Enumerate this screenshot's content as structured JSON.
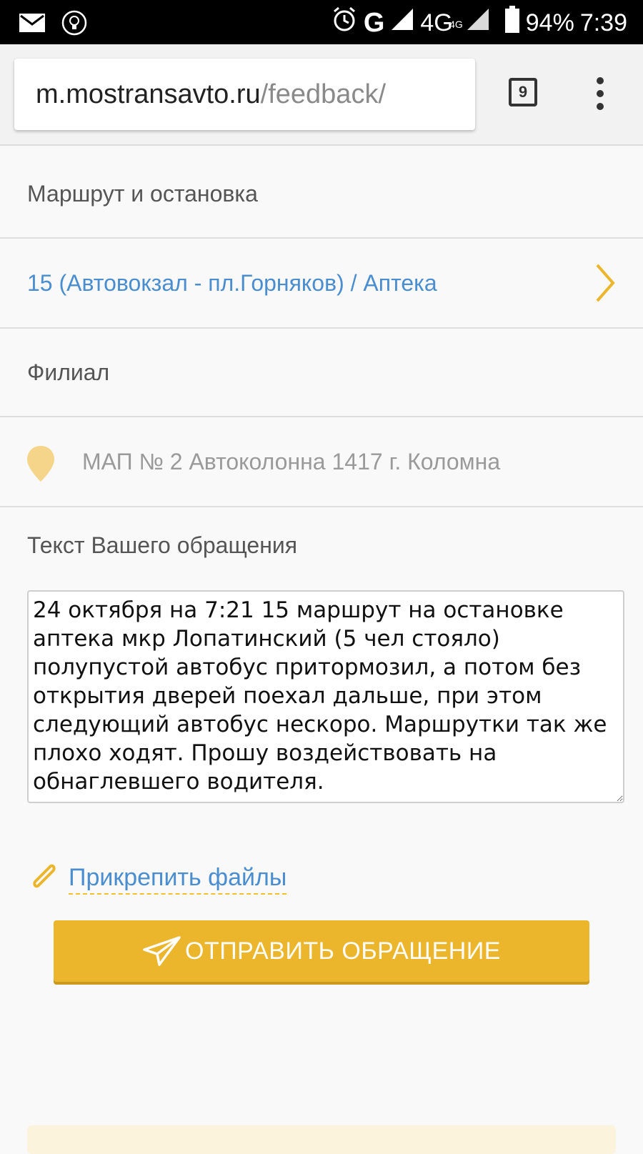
{
  "status_bar": {
    "network_g": "G",
    "network_4g": "4G",
    "network_4g_small": "4G",
    "battery": "94%",
    "time": "7:39"
  },
  "browser": {
    "url_host": "m.mostransavto.ru",
    "url_path": "/feedback/",
    "tab_count": "9"
  },
  "form": {
    "route_label": "Маршрут и остановка",
    "route_value": "15 (Автовокзал - пл.Горняков) / Аптека",
    "branch_label": "Филиал",
    "branch_value": "МАП № 2 Автоколонна 1417 г. Коломна",
    "text_label": "Текст Вашего обращения",
    "text_value": "24 октября на 7:21 15 маршрут на остановке аптека мкр Лопатинский (5 чел стояло) полупустой автобус притормозил, а потом без открытия дверей поехал дальше, при этом следующий автобус нескоро. Маршрутки так же плохо ходят. Прошу воздействовать на обнаглевшего водителя.",
    "attach_label": "Прикрепить файлы",
    "submit_label": "ОТПРАВИТЬ ОБРАЩЕНИЕ"
  },
  "colors": {
    "accent": "#ecb62c",
    "link": "#4a8ed0"
  }
}
